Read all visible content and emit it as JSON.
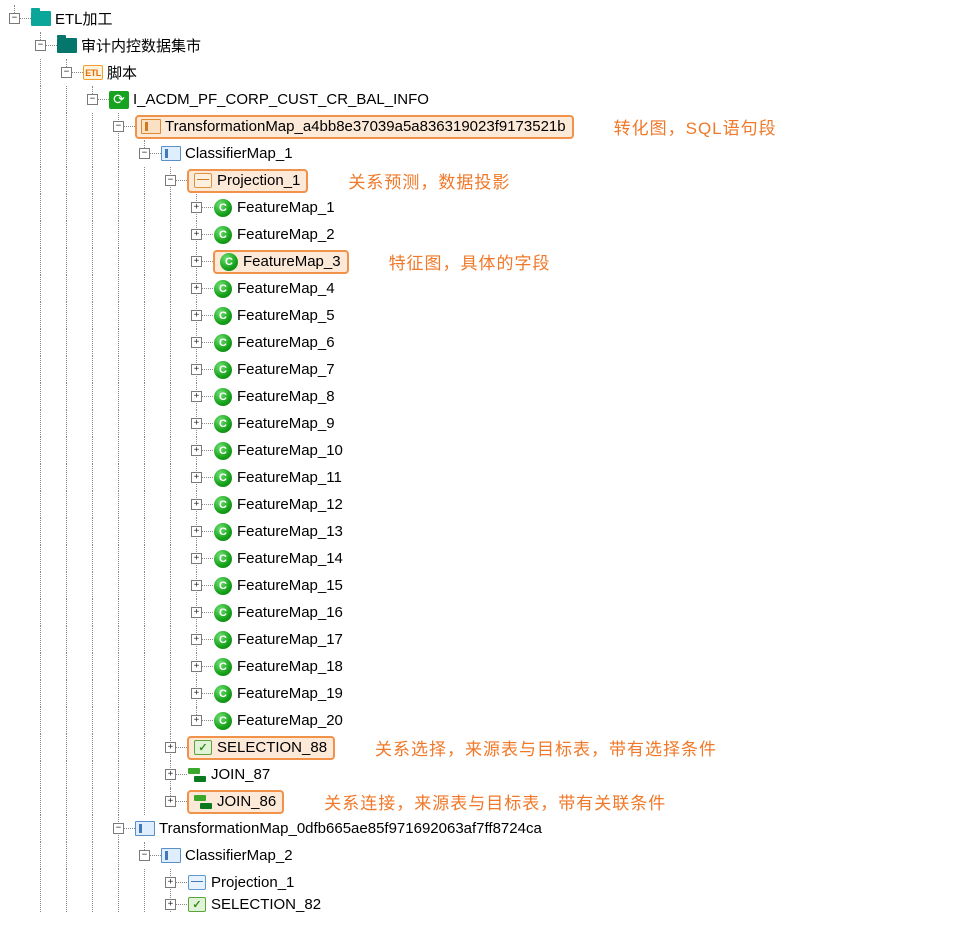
{
  "root": {
    "label": "ETL加工"
  },
  "sub": {
    "label": "审计内控数据集市"
  },
  "script": {
    "label": "脚本",
    "badge": "ETL"
  },
  "task": {
    "label": "I_ACDM_PF_CORP_CUST_CR_BAL_INFO"
  },
  "tmap1": {
    "label": "TransformationMap_a4bb8e37039a5a836319023f9173521b"
  },
  "annot_tmap": "转化图，SQL语句段",
  "cmap1": {
    "label": "ClassifierMap_1"
  },
  "proj1": {
    "label": "Projection_1"
  },
  "annot_proj": "关系预测，数据投影",
  "features": [
    "FeatureMap_1",
    "FeatureMap_2",
    "FeatureMap_3",
    "FeatureMap_4",
    "FeatureMap_5",
    "FeatureMap_6",
    "FeatureMap_7",
    "FeatureMap_8",
    "FeatureMap_9",
    "FeatureMap_10",
    "FeatureMap_11",
    "FeatureMap_12",
    "FeatureMap_13",
    "FeatureMap_14",
    "FeatureMap_15",
    "FeatureMap_16",
    "FeatureMap_17",
    "FeatureMap_18",
    "FeatureMap_19",
    "FeatureMap_20"
  ],
  "annot_feat": "特征图，具体的字段",
  "sel88": {
    "label": "SELECTION_88"
  },
  "annot_sel": "关系选择，来源表与目标表，带有选择条件",
  "join87": {
    "label": "JOIN_87"
  },
  "join86": {
    "label": "JOIN_86"
  },
  "annot_join": "关系连接，来源表与目标表，带有关联条件",
  "tmap2": {
    "label": "TransformationMap_0dfb665ae85f971692063af7ff8724ca"
  },
  "cmap2": {
    "label": "ClassifierMap_2"
  },
  "proj2": {
    "label": "Projection_1"
  },
  "sel82": {
    "label": "SELECTION_82"
  },
  "feat_letter": "C",
  "sel_mark": "✓"
}
